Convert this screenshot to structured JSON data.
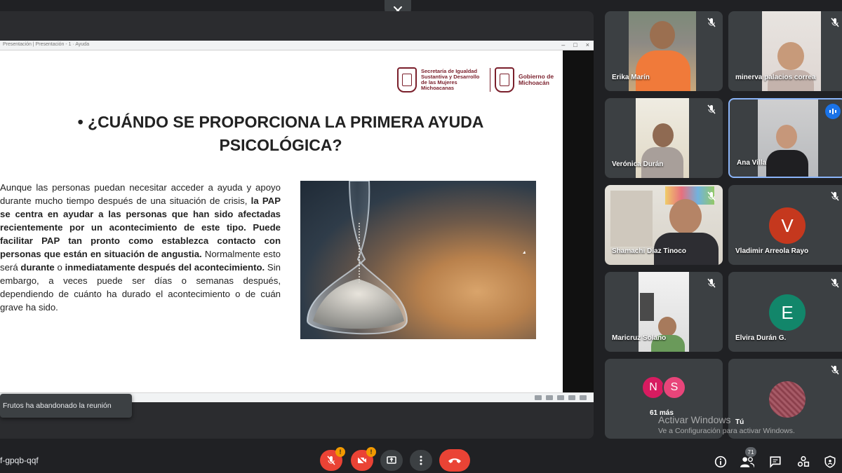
{
  "top": {
    "close_icon": "close-icon"
  },
  "browser": {
    "url_text": "Presentación  |  Presentación - 1 · Ayuda",
    "win_min": "–",
    "win_max": "□",
    "win_close": "×"
  },
  "slide": {
    "logo_left": "Secretaría de Igualdad Sustantiva y Desarrollo de las Mujeres Michoacanas",
    "logo_right": "Gobierno de Michoacán",
    "title": "• ¿CUÁNDO SE PROPORCIONA LA PRIMERA AYUDA PSICOLÓGICA?",
    "body": {
      "p1": "Aunque las personas puedan necesitar acceder a ayuda y apoyo durante mucho tiempo después de una situación de crisis, ",
      "b1": "la PAP se centra en ayudar a las personas que han sido afectadas recientemente por un acontecimiento de este tipo. Puede facilitar PAP tan pronto como establezca contacto con personas que están en situación de angustia.",
      "p2": " Normalmente esto será ",
      "b2": "durante",
      "p3": " o ",
      "b3": "inmediatamente después del acontecimiento.",
      "p4": " Sin embargo, a veces puede ser días o semanas después, dependiendo de cuánto ha durado el acontecimiento o de cuán grave ha sido."
    },
    "image": "hourglass-image"
  },
  "participants": [
    {
      "name": "Erika Marín",
      "muted": true
    },
    {
      "name": "minerva palacios correa",
      "muted": true
    },
    {
      "name": "Verónica Durán",
      "muted": true
    },
    {
      "name": "Ana Villa",
      "speaking": true
    },
    {
      "name": "Shamachi Díaz Tinoco",
      "muted": true
    },
    {
      "name": "Vladimir Arreola Rayo",
      "initial": "V",
      "color": "#c5381e",
      "muted": true
    },
    {
      "name": "Maricruz Solano",
      "muted": true
    },
    {
      "name": "Elvira Durán G.",
      "initial": "E",
      "color": "#12866a",
      "muted": true
    }
  ],
  "more": {
    "initials": [
      "N",
      "S"
    ],
    "colors": [
      "#d81b60",
      "#e8457a"
    ],
    "label": "61 más"
  },
  "self_tile": {
    "label": "Tú"
  },
  "toast": {
    "text": "Frutos ha abandonado la reunión"
  },
  "watermark": {
    "line1": "Activar Windows",
    "line2": "Ve a Configuración para activar Windows."
  },
  "bottom": {
    "meeting_code": "f-gpqb-qqf",
    "warn_mark": "!",
    "people_count": "71"
  },
  "colors": {
    "end_call": "#ea4335",
    "mic_off": "#ea4335",
    "accent": "#8ab4f8",
    "speaking": "#1a73e8"
  }
}
